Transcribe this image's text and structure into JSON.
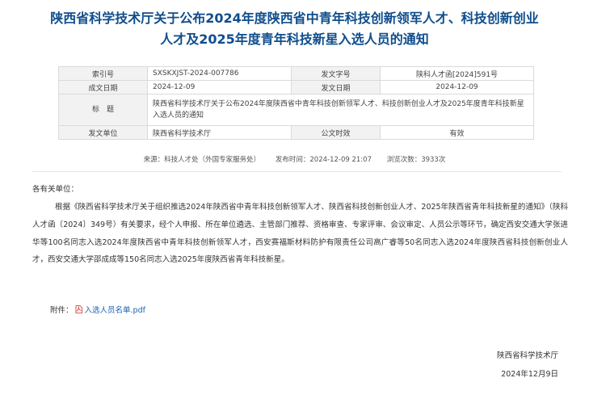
{
  "title_line1": "陕西省科学技术厅关于公布2024年度陕西省中青年科技创新领军人才、科技创新创业",
  "title_line2": "人才及2025年度青年科技新星入选人员的通知",
  "meta": {
    "index_label": "索引号",
    "index_value": "SXSKXJST-2024-007786",
    "doc_no_label": "发文字号",
    "doc_no_value": "陕科人才函[2024]591号",
    "created_label": "成文日期",
    "created_value": "2024-12-09",
    "issued_label": "发文日期",
    "issued_value": "2024-12-09",
    "subject_label": "标　题",
    "subject_value": "陕西省科学技术厅关于公布2024年度陕西省中青年科技创新领军人才、科技创新创业人才及2025年度青年科技新星入选人员的通知",
    "issuer_label": "发文单位",
    "issuer_value": "陕西省科学技术厅",
    "validity_label": "公文时效",
    "validity_value": "有效"
  },
  "info": {
    "source": "来源：科技人才处（外国专家服务处）",
    "published": "发布时间：2024-12-09 21:07",
    "views": "浏览次数：3933次"
  },
  "salutation": "各有关单位：",
  "body": "根据《陕西省科学技术厅关于组织推选2024年陕西省中青年科技创新领军人才、陕西省科技创新创业人才、2025年陕西省青年科技新星的通知》（陕科人才函〔2024〕349号）有关要求，经个人申报、所在单位遴选、主管部门推荐、资格审查、专家评审、会议审定、人员公示等环节，确定西安交通大学张进华等100名同志入选2024年度陕西省中青年科技创新领军人才，西安赛福斯材料防护有限责任公司高广睿等50名同志入选2024年度陕西省科技创新创业人才，西安交通大学邵成成等150名同志入选2025年度陕西省青年科技新星。",
  "attachment": {
    "label": "附件：",
    "file": "入选人员名单.pdf"
  },
  "signature": {
    "org": "陕西省科学技术厅",
    "date": "2024年12月9日"
  }
}
